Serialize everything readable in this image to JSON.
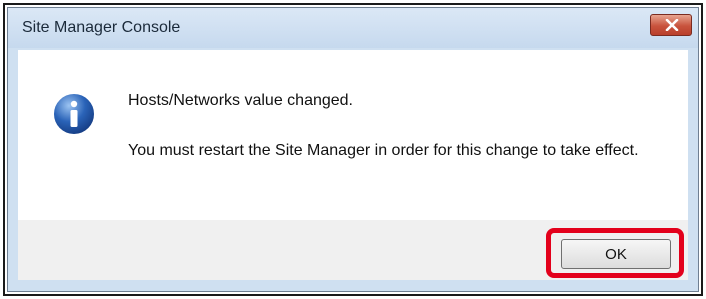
{
  "window": {
    "title": "Site Manager Console",
    "close_icon": "close-icon"
  },
  "message": {
    "icon": "info-icon",
    "line1": "Hosts/Networks value changed.",
    "line2": "You must restart the Site Manager in order for this change to take effect."
  },
  "buttons": {
    "ok_label": "OK"
  },
  "colors": {
    "highlight": "#e3001b",
    "close_button": "#c8533d",
    "info_icon": "#2a63b8"
  }
}
